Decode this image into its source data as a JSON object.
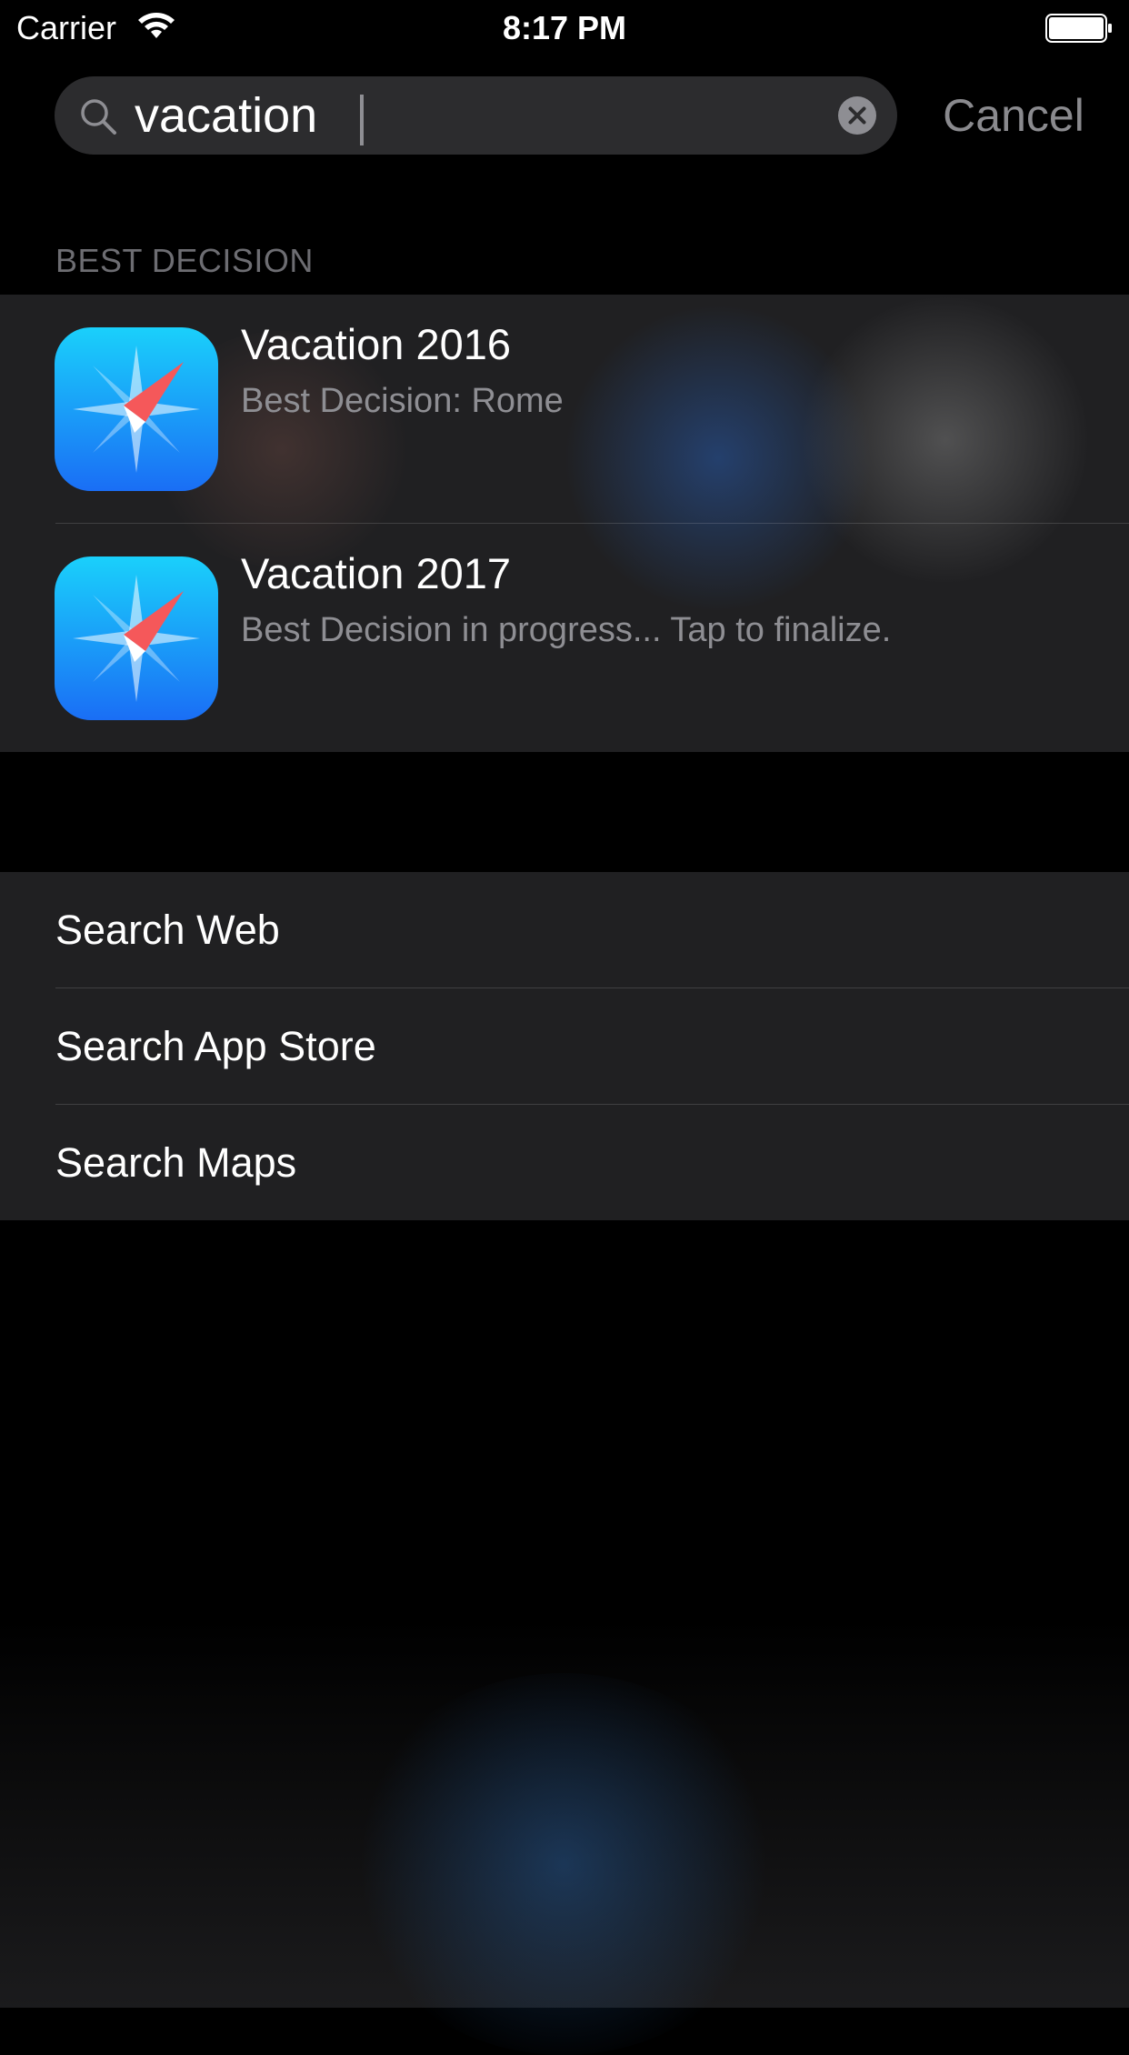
{
  "status_bar": {
    "carrier": "Carrier",
    "time": "8:17 PM",
    "wifi_icon": "wifi-icon",
    "battery_icon": "battery-icon"
  },
  "search": {
    "value": "vacation",
    "search_icon": "magnifying-glass-icon",
    "clear_icon": "clear-x-icon",
    "cancel_label": "Cancel"
  },
  "section": {
    "header": "BEST DECISION"
  },
  "results": [
    {
      "title": "Vacation 2016",
      "subtitle": "Best Decision: Rome",
      "icon": "compass-app-icon"
    },
    {
      "title": "Vacation 2017",
      "subtitle": "Best Decision in progress... Tap to finalize.",
      "icon": "compass-app-icon"
    }
  ],
  "search_options": [
    {
      "label": "Search Web"
    },
    {
      "label": "Search App Store"
    },
    {
      "label": "Search Maps"
    }
  ],
  "colors": {
    "background": "#000000",
    "panel": "#202022",
    "field": "#2c2c2e",
    "secondary_text": "#8e8e93",
    "icon_gradient_top": "#1ad0fb",
    "icon_gradient_bottom": "#1a6ef5",
    "compass_needle": "#f5585a"
  }
}
